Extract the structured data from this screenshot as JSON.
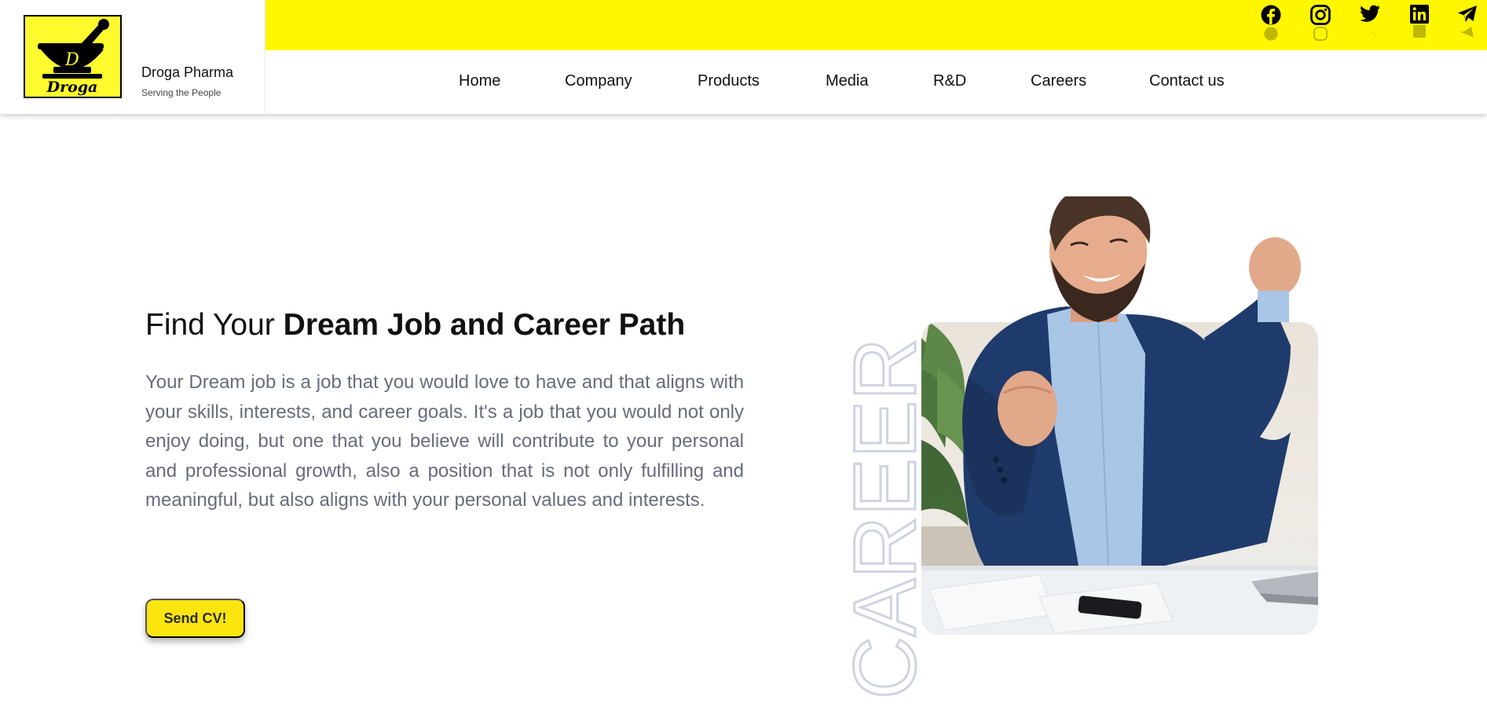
{
  "brand": {
    "logo_text": "Droga",
    "logo_letter": "D",
    "name": "Droga Pharma",
    "tagline": "Serving the People"
  },
  "colors": {
    "accent_yellow": "#fff700",
    "button_yellow": "#fbe50f",
    "body_text": "#676c7d",
    "career_outline": "#cfd3e2"
  },
  "social": [
    {
      "name": "facebook",
      "icon": "facebook-icon"
    },
    {
      "name": "instagram",
      "icon": "instagram-icon"
    },
    {
      "name": "twitter",
      "icon": "twitter-icon"
    },
    {
      "name": "linkedin",
      "icon": "linkedin-icon"
    },
    {
      "name": "telegram",
      "icon": "telegram-icon"
    }
  ],
  "nav": {
    "items": [
      "Home",
      "Company",
      "Products",
      "Media",
      "R&D",
      "Careers",
      "Contact us"
    ]
  },
  "hero": {
    "title_light": "Find Your",
    "title_bold": "Dream Job and Career Path",
    "paragraph": "Your Dream job is a job that you would love to have and that aligns with your skills, interests, and career goals. It's a job that you would not only enjoy doing, but one that you believe will contribute to your personal and professional growth, also a position that is not only fulfilling and meaningful, but also aligns with your personal values and interests.",
    "cta_label": "Send CV!",
    "vertical_word": "CAREER"
  }
}
